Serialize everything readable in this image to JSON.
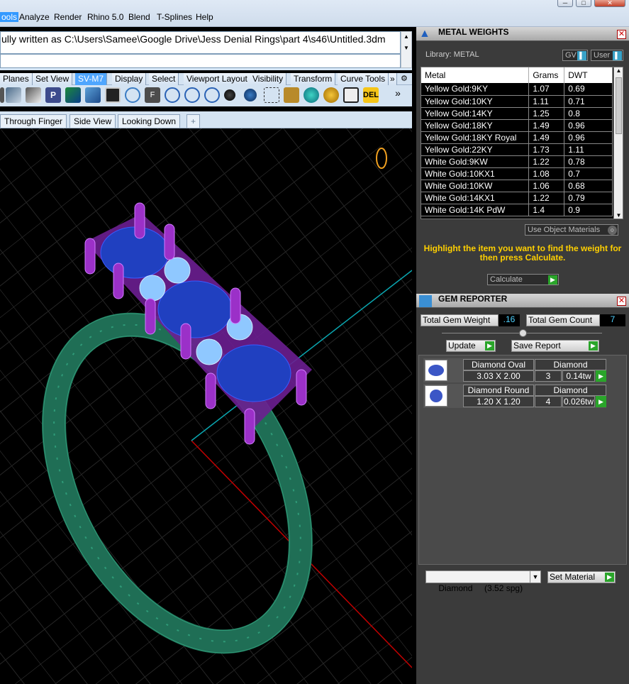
{
  "menu": {
    "items": [
      "ools",
      "Analyze",
      "Render",
      "Rhino 5.0",
      "Blend",
      "T-Splines",
      "Help"
    ],
    "window_buttons": [
      "─",
      "□",
      "✕"
    ]
  },
  "command": {
    "history": "ully written as C:\\Users\\Samee\\Google Drive\\Jess Denial Rings\\part 4\\s46\\Untitled.3dm",
    "input": ""
  },
  "toolbar_tabs": [
    "Planes",
    "Set View",
    "SV-M7",
    "Display",
    "Select",
    "Viewport Layout",
    "Visibility",
    "Transform",
    "Curve Tools"
  ],
  "toolbar_overflow": "»",
  "viewport_tabs": [
    "Through Finger",
    "Side View",
    "Looking Down",
    "+"
  ],
  "metal_weights": {
    "title": "METAL WEIGHTS",
    "library_label": "Library: METAL",
    "gv_label": "GV",
    "user_label": "User",
    "columns": [
      "Metal",
      "Grams",
      "DWT"
    ],
    "rows": [
      [
        "Yellow Gold:9KY",
        "1.07",
        "0.69"
      ],
      [
        "Yellow Gold:10KY",
        "1.11",
        "0.71"
      ],
      [
        "Yellow Gold:14KY",
        "1.25",
        "0.8"
      ],
      [
        "Yellow Gold:18KY",
        "1.49",
        "0.96"
      ],
      [
        "Yellow Gold:18KY Royal",
        "1.49",
        "0.96"
      ],
      [
        "Yellow Gold:22KY",
        "1.73",
        "1.11"
      ],
      [
        "White Gold:9KW",
        "1.22",
        "0.78"
      ],
      [
        "White Gold:10KX1",
        "1.08",
        "0.7"
      ],
      [
        "White Gold:10KW",
        "1.06",
        "0.68"
      ],
      [
        "White Gold:14KX1",
        "1.22",
        "0.79"
      ],
      [
        "White Gold:14K PdW",
        "1.4",
        "0.9"
      ]
    ],
    "use_object_materials": "Use Object Materials",
    "instruction": "Highlight the item you want to find the weight for then press Calculate.",
    "calculate": "Calculate"
  },
  "gem_reporter": {
    "title": "GEM REPORTER",
    "total_weight_label": "Total Gem Weight",
    "total_weight_value": ".16",
    "total_count_label": "Total Gem Count",
    "total_count_value": "7",
    "update": "Update",
    "save_report": "Save Report",
    "gems": [
      {
        "name": "Diamond Oval",
        "type": "Diamond",
        "size": "3.03 X 2.00",
        "count": "3",
        "weight": "0.14tw"
      },
      {
        "name": "Diamond Round",
        "type": "Diamond",
        "size": "1.20 X 1.20",
        "count": "4",
        "weight": "0.026tw"
      }
    ],
    "material_select": "Diamond     (3.52 spg)",
    "set_material": "Set Material"
  },
  "colors": {
    "grid": "#3a3a3a",
    "band": "#1f6e55",
    "prongs": "#9b30c8",
    "gem": "#2040c0",
    "accent_axis_x": "#c00000",
    "accent_axis_y": "#0aa6b0",
    "instruction_text": "#ffd000"
  }
}
